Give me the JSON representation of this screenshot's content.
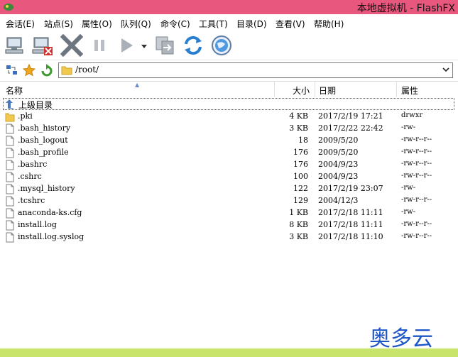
{
  "window": {
    "title": "本地虚拟机 - FlashFX"
  },
  "menu": [
    "会话(E)",
    "站点(S)",
    "属性(O)",
    "队列(Q)",
    "命令(C)",
    "工具(T)",
    "目录(D)",
    "查看(V)",
    "帮助(H)"
  ],
  "toolbar": {
    "buttons": [
      "connect-icon",
      "disconnect-icon",
      "stop-icon",
      "pause-icon",
      "play-icon",
      "transfer-dropdown-icon",
      "refresh-icon",
      "internet-icon"
    ]
  },
  "address": {
    "path": "/root/"
  },
  "columns": {
    "name": "名称",
    "size": "大小",
    "date": "日期",
    "attr": "属性"
  },
  "parent_row": {
    "label": "上级目录"
  },
  "files": [
    {
      "name": ".pki",
      "size": "4 KB",
      "date": "2017/2/19 17:21",
      "attr": "drwxr",
      "type": "folder"
    },
    {
      "name": ".bash_history",
      "size": "3 KB",
      "date": "2017/2/22 22:42",
      "attr": "-rw-",
      "type": "file"
    },
    {
      "name": ".bash_logout",
      "size": "18",
      "date": "2009/5/20",
      "attr": "-rw-r--r--",
      "type": "file"
    },
    {
      "name": ".bash_profile",
      "size": "176",
      "date": "2009/5/20",
      "attr": "-rw-r--r--",
      "type": "file"
    },
    {
      "name": ".bashrc",
      "size": "176",
      "date": "2004/9/23",
      "attr": "-rw-r--r--",
      "type": "file"
    },
    {
      "name": ".cshrc",
      "size": "100",
      "date": "2004/9/23",
      "attr": "-rw-r--r--",
      "type": "file"
    },
    {
      "name": ".mysql_history",
      "size": "122",
      "date": "2017/2/19 23:07",
      "attr": "-rw-",
      "type": "file"
    },
    {
      "name": ".tcshrc",
      "size": "129",
      "date": "2004/12/3",
      "attr": "-rw-r--r--",
      "type": "file"
    },
    {
      "name": "anaconda-ks.cfg",
      "size": "1 KB",
      "date": "2017/2/18 11:11",
      "attr": "-rw-",
      "type": "file"
    },
    {
      "name": "install.log",
      "size": "8 KB",
      "date": "2017/2/18 11:11",
      "attr": "-rw-r--r--",
      "type": "file"
    },
    {
      "name": "install.log.syslog",
      "size": "3 KB",
      "date": "2017/2/18 11:10",
      "attr": "-rw-r--r--",
      "type": "file"
    }
  ],
  "watermark": "奥多云",
  "colors": {
    "titlebar": "#e8577d",
    "statusbar": "#c8e46a",
    "watermark": "#1e56c8"
  }
}
